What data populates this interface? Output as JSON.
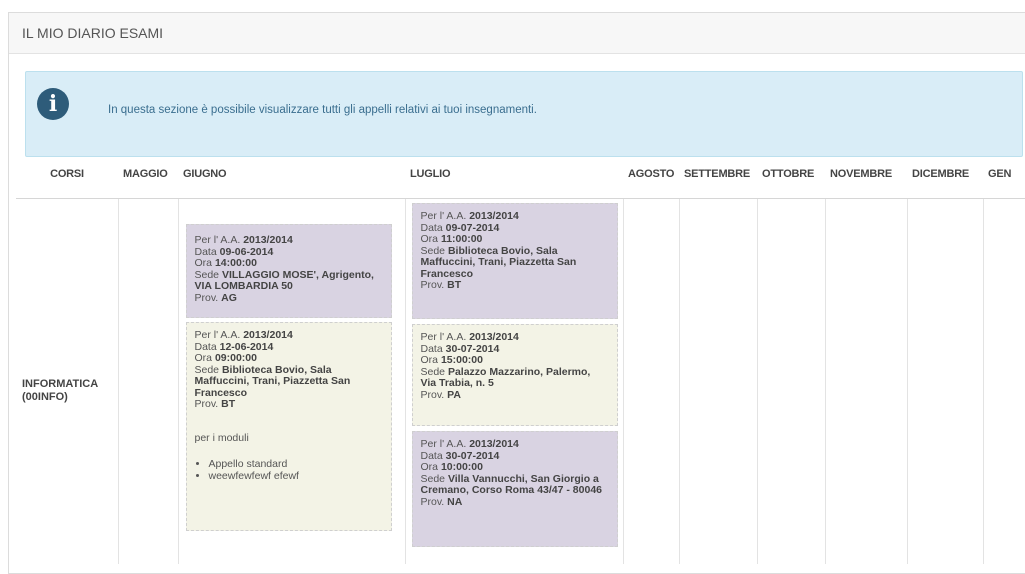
{
  "panel": {
    "title": "IL MIO DIARIO ESAMI"
  },
  "alert": {
    "icon": "info-icon",
    "text": "In questa sezione è possibile visualizzare tutti gli appelli relativi ai tuoi insegnamenti."
  },
  "table": {
    "headers": [
      "CORSI",
      "MAGGIO",
      "GIUGNO",
      "LUGLIO",
      "AGOSTO",
      "SETTEMBRE",
      "OTTOBRE",
      "NOVEMBRE",
      "DICEMBRE",
      "GEN"
    ],
    "course": {
      "name": "INFORMATICA",
      "code": "(00INFO)"
    },
    "giugno": [
      {
        "color": "#d9d3e2",
        "aa_label": "Per l' A.A.",
        "aa": "2013/2014",
        "data_label": "Data",
        "data": "09-06-2014",
        "ora_label": "Ora",
        "ora": "14:00:00",
        "sede_label": "Sede",
        "sede": "VILLAGGIO MOSE', Agrigento, VIA LOMBARDIA 50",
        "prov_label": "Prov.",
        "prov": "AG"
      },
      {
        "color": "#f3f3e6",
        "aa_label": "Per l' A.A.",
        "aa": "2013/2014",
        "data_label": "Data",
        "data": "12-06-2014",
        "ora_label": "Ora",
        "ora": "09:00:00",
        "sede_label": "Sede",
        "sede": "Biblioteca Bovio, Sala Maffuccini, Trani, Piazzetta San Francesco",
        "prov_label": "Prov.",
        "prov": "BT",
        "moduli_label": "per i moduli",
        "moduli": [
          "Appello standard",
          "weewfewfewf efewf"
        ]
      }
    ],
    "luglio": [
      {
        "color": "#d9d3e2",
        "aa_label": "Per l' A.A.",
        "aa": "2013/2014",
        "data_label": "Data",
        "data": "09-07-2014",
        "ora_label": "Ora",
        "ora": "11:00:00",
        "sede_label": "Sede",
        "sede": "Biblioteca Bovio, Sala Maffuccini, Trani, Piazzetta San Francesco",
        "prov_label": "Prov.",
        "prov": "BT"
      },
      {
        "color": "#f3f3e6",
        "aa_label": "Per l' A.A.",
        "aa": "2013/2014",
        "data_label": "Data",
        "data": "30-07-2014",
        "ora_label": "Ora",
        "ora": "15:00:00",
        "sede_label": "Sede",
        "sede": "Palazzo Mazzarino, Palermo, Via Trabia, n. 5",
        "prov_label": "Prov.",
        "prov": "PA"
      },
      {
        "color": "#d9d3e2",
        "aa_label": "Per l' A.A.",
        "aa": "2013/2014",
        "data_label": "Data",
        "data": "30-07-2014",
        "ora_label": "Ora",
        "ora": "10:00:00",
        "sede_label": "Sede",
        "sede": "Villa Vannucchi, San Giorgio a Cremano, Corso Roma 43/47 - 80046",
        "prov_label": "Prov.",
        "prov": "NA"
      }
    ]
  }
}
